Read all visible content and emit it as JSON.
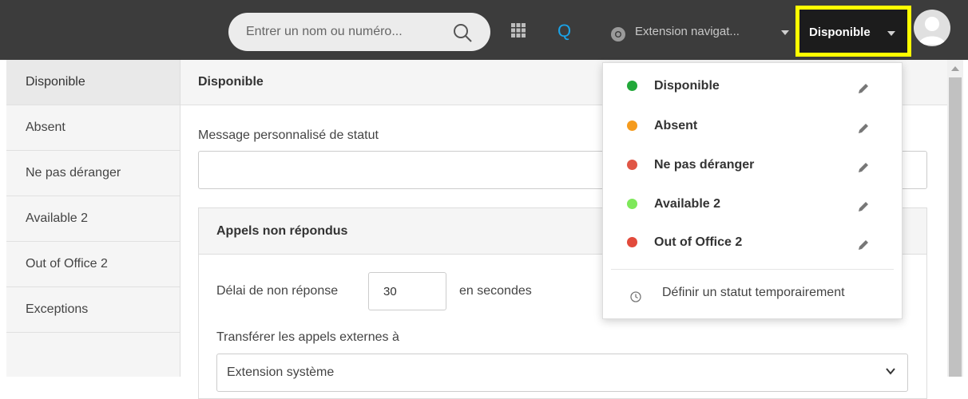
{
  "topbar": {
    "search_placeholder": "Entrer un nom ou numéro...",
    "logo_text": "Q",
    "extension_label": "Extension navigat...",
    "status_label": "Disponible"
  },
  "sidebar": {
    "items": [
      {
        "label": "Disponible"
      },
      {
        "label": "Absent"
      },
      {
        "label": "Ne pas déranger"
      },
      {
        "label": "Available 2"
      },
      {
        "label": "Out of Office 2"
      },
      {
        "label": "Exceptions"
      }
    ]
  },
  "main": {
    "title": "Disponible",
    "message_label": "Message personnalisé de statut",
    "message_value": "",
    "missed_calls": {
      "heading": "Appels non répondus",
      "delay_label": "Délai de non réponse",
      "delay_value": "30",
      "delay_unit": "en secondes",
      "transfer_label": "Transférer les appels externes à",
      "transfer_value": "Extension système"
    }
  },
  "status_menu": {
    "items": [
      {
        "label": "Disponible",
        "color": "#22a83a"
      },
      {
        "label": "Absent",
        "color": "#f59b1e"
      },
      {
        "label": "Ne pas déranger",
        "color": "#e05646"
      },
      {
        "label": "Available 2",
        "color": "#7ee85a"
      },
      {
        "label": "Out of Office 2",
        "color": "#e24a3b"
      }
    ],
    "temporary_label": "Définir un statut temporairement"
  },
  "colors": {
    "accent_highlight": "#ffff00",
    "logo_blue": "#1aa3e8"
  }
}
